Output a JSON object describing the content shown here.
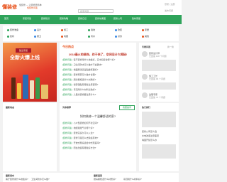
{
  "header": {
    "logo": "懂装修",
    "sub1": "懂装修 — 让装修更简单",
    "sub2": "懂装修问答",
    "search_placeholder": "搜索问题",
    "right1": "登录 | 注册",
    "right2": "发布问题"
  },
  "nav": {
    "items": [
      "首页",
      "家装问答",
      "装修知识",
      "装修攻略",
      "装修日记",
      "装修效果图",
      "装修公司",
      "建材家居"
    ]
  },
  "categories": [
    {
      "label": "装修准备",
      "color": "#2ea35a"
    },
    {
      "label": "设计",
      "color": "#3b8ae6"
    },
    {
      "label": "施工",
      "color": "#e8541e"
    },
    {
      "label": "验收",
      "color": "#2ea35a"
    },
    {
      "label": "软装",
      "color": "#3b8ae6"
    },
    {
      "label": "家居",
      "color": "#e8541e"
    },
    {
      "label": "建材",
      "color": "#2ea35a"
    },
    {
      "label": "厨卫",
      "color": "#3b8ae6"
    },
    {
      "label": "电器",
      "color": "#e8541e"
    },
    {
      "label": "风水",
      "color": "#2ea35a"
    },
    {
      "label": "贷款",
      "color": "#3b8ae6"
    },
    {
      "label": "其他",
      "color": "#e8541e"
    }
  ],
  "banner": {
    "badge": "酷爱家居",
    "title": "全新火爆上线"
  },
  "today": {
    "label": "今日热点",
    "headline": "2018最火的装饰，终于来了，空间设计大揭秘!",
    "rows": [
      {
        "tag": "[装修问答]",
        "text": "客厅装修用什么地板好，实木和复合哪个好?"
      },
      {
        "tag": "[装修问答]",
        "text": "卫生间防水怎么做才不会漏水?"
      },
      {
        "tag": "[装修问答]",
        "text": "墙面刷漆还是贴壁纸更好?"
      },
      {
        "tag": "[装修问答]",
        "text": "装修预算怎么做才合理?"
      },
      {
        "tag": "[装修问答]",
        "text": "厨房橱柜选什么材质好?"
      },
      {
        "tag": "[装修问答]",
        "text": "瓷砖铺贴有哪些注意事项?"
      },
      {
        "tag": "[装修问答]",
        "text": "吊顶用什么材料比较好?"
      },
      {
        "tag": "[装修问答]",
        "text": "儿童房装修要注意什么?"
      }
    ]
  },
  "experts": {
    "title": "专家问答",
    "subtitle": "换一换",
    "items": [
      {
        "name": "装修设计师",
        "desc": "已回答 128 个问题"
      },
      {
        "name": "施工工长",
        "desc": "已回答 96 个问题"
      },
      {
        "name": "监理专家",
        "desc": "已回答 75 个问题"
      }
    ]
  },
  "latest": {
    "title": "最新动态"
  },
  "ask": {
    "title": "为你推荐",
    "button": "我要提问",
    "question": "如何装修一个温馨舒适的家?",
    "rows": [
      {
        "tag": "[装修问答]",
        "text": "小户型装修如何节省空间?"
      },
      {
        "tag": "[装修问答]",
        "text": "地暖和暖气片哪个好?"
      },
      {
        "tag": "[装修问答]",
        "text": "装修完多久可以入住?"
      },
      {
        "tag": "[装修问答]",
        "text": "装修污染怎么去除最有效?"
      },
      {
        "tag": "[装修问答]",
        "text": "开放式厨房适合中式家庭吗?"
      },
      {
        "tag": "[装修问答]",
        "text": "阳台改造有哪些好方法?"
      }
    ]
  },
  "ranking": {
    "title": "热门排行",
    "items": [
      "装修公司怎么选",
      "水电改造注意事项",
      "墙面开裂怎么办"
    ]
  },
  "bottom": {
    "left_title": "最新发布",
    "right_title": "最新回答",
    "left_items": [
      "客厅装修用什么地板好?",
      "卫生间防水怎么做?"
    ],
    "right_items": [
      "厨房橱柜选什么材质好?",
      "吊顶用什么材料好?"
    ]
  }
}
